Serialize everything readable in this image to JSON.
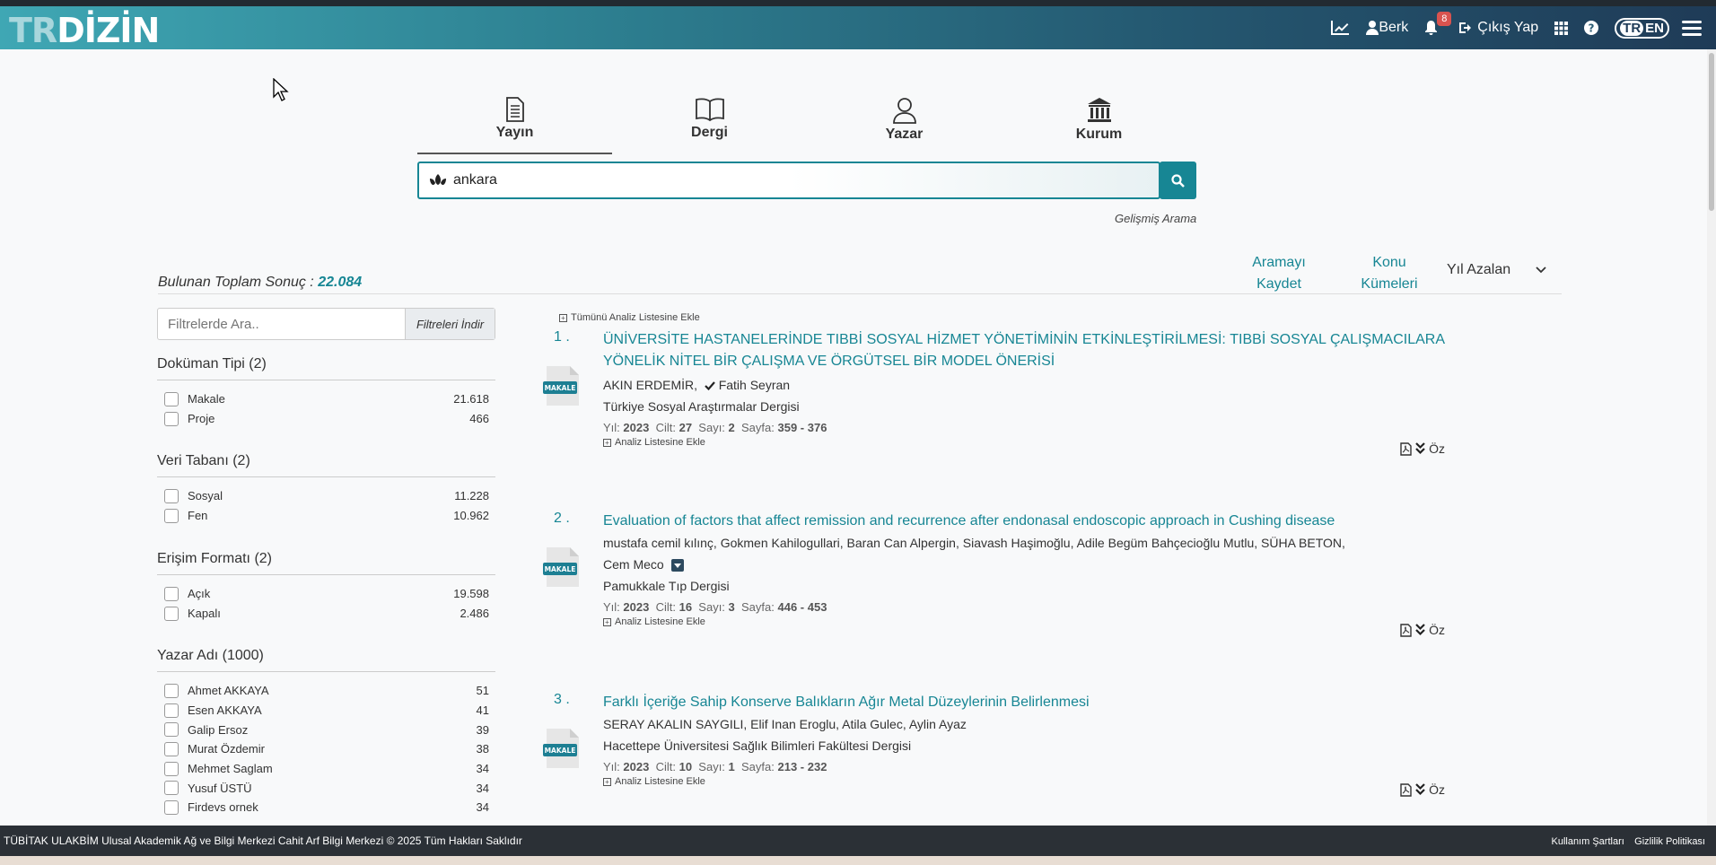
{
  "header": {
    "logo_prefix": "TR",
    "logo_main": "DİZİN",
    "user_name": "Berk",
    "notification_count": "8",
    "logout_label": "Çıkış Yap",
    "lang_tr": "TR",
    "lang_en": "EN"
  },
  "tabs": [
    {
      "label": "Yayın",
      "icon": "document-icon",
      "active": true
    },
    {
      "label": "Dergi",
      "icon": "book-icon",
      "active": false
    },
    {
      "label": "Yazar",
      "icon": "user-icon",
      "active": false
    },
    {
      "label": "Kurum",
      "icon": "institution-icon",
      "active": false
    }
  ],
  "search": {
    "value": "ankara",
    "advanced_label": "Gelişmiş Arama"
  },
  "results_header": {
    "total_label": "Bulunan Toplam Sonuç :",
    "total_value": "22.084",
    "save_search_line1": "Aramayı",
    "save_search_line2": "Kaydet",
    "topic_clusters_line1": "Konu",
    "topic_clusters_line2": "Kümeleri",
    "sort_label": "Yıl Azalan"
  },
  "filters": {
    "search_placeholder": "Filtrelerde Ara..",
    "download_label": "Filtreleri İndir",
    "groups": [
      {
        "title": "Doküman Tipi (2)",
        "items": [
          {
            "name": "Makale",
            "count": "21.618"
          },
          {
            "name": "Proje",
            "count": "466"
          }
        ]
      },
      {
        "title": "Veri Tabanı (2)",
        "items": [
          {
            "name": "Sosyal",
            "count": "11.228"
          },
          {
            "name": "Fen",
            "count": "10.962"
          }
        ]
      },
      {
        "title": "Erişim Formatı (2)",
        "items": [
          {
            "name": "Açık",
            "count": "19.598"
          },
          {
            "name": "Kapalı",
            "count": "2.486"
          }
        ]
      },
      {
        "title": "Yazar Adı (1000)",
        "items": [
          {
            "name": "Ahmet AKKAYA",
            "count": "51"
          },
          {
            "name": "Esen AKKAYA",
            "count": "41"
          },
          {
            "name": "Galip Ersoz",
            "count": "39"
          },
          {
            "name": "Murat Özdemir",
            "count": "38"
          },
          {
            "name": "Mehmet Saglam",
            "count": "34"
          },
          {
            "name": "Yusuf ÜSTÜ",
            "count": "34"
          },
          {
            "name": "Firdevs ornek",
            "count": "34"
          }
        ]
      }
    ]
  },
  "add_all_label": "Tümünü Analiz Listesine Ekle",
  "results": [
    {
      "num": "1 .",
      "doc_type": "MAKALE",
      "title": "ÜNİVERSİTE HASTANELERİNDE TIBBİ SOSYAL HİZMET YÖNETİMİNİN ETKİNLEŞTİRİLMESİ: TIBBİ SOSYAL ÇALIŞMACILARA YÖNELİK NİTEL BİR ÇALIŞMA VE ÖRGÜTSEL BİR MODEL ÖNERİSİ",
      "author1": "AKIN ERDEMİR,",
      "author2": "Fatih Seyran",
      "journal": "Türkiye Sosyal Araştırmalar Dergisi",
      "year": "2023",
      "volume": "27",
      "issue": "2",
      "pages": "359 - 376"
    },
    {
      "num": "2 .",
      "doc_type": "MAKALE",
      "title": "Evaluation of factors that affect remission and recurrence after endonasal endoscopic approach in Cushing disease",
      "authors_line": "mustafa cemil kılınç,  Gokmen Kahilogullari,  Baran Can Alpergin,  Siavash Haşimoğlu,  Adile Begüm Bahçecioğlu Mutlu,  SÜHA BETON,",
      "authors_line2": "Cem Meco",
      "journal": "Pamukkale Tıp Dergisi",
      "year": "2023",
      "volume": "16",
      "issue": "3",
      "pages": "446 - 453"
    },
    {
      "num": "3 .",
      "doc_type": "MAKALE",
      "title": "Farklı İçeriğe Sahip Konserve Balıkların Ağır Metal Düzeylerinin Belirlenmesi",
      "authors_line": "SERAY AKALIN SAYGILI,  Elif Inan Eroglu,  Atila Gulec,  Aylin Ayaz",
      "journal": "Hacettepe Üniversitesi Sağlık Bilimleri Fakültesi Dergisi",
      "year": "2023",
      "volume": "10",
      "issue": "1",
      "pages": "213 - 232"
    }
  ],
  "labels": {
    "year": "Yıl:",
    "volume": "Cilt:",
    "issue": "Sayı:",
    "page": "Sayfa:",
    "add_analysis": "Analiz Listesine Ekle",
    "abstract": "Öz"
  },
  "footer": {
    "copyright": "TÜBİTAK ULAKBİM Ulusal Akademik Ağ ve Bilgi Merkezi Cahit Arf Bilgi Merkezi © 2025 Tüm Hakları Saklıdır",
    "terms": "Kullanım Şartları",
    "privacy": "Gizlilik Politikası"
  },
  "colors": {
    "accent": "#178694",
    "navbar_start": "#3fa7b4",
    "navbar_end": "#1f3b57"
  }
}
